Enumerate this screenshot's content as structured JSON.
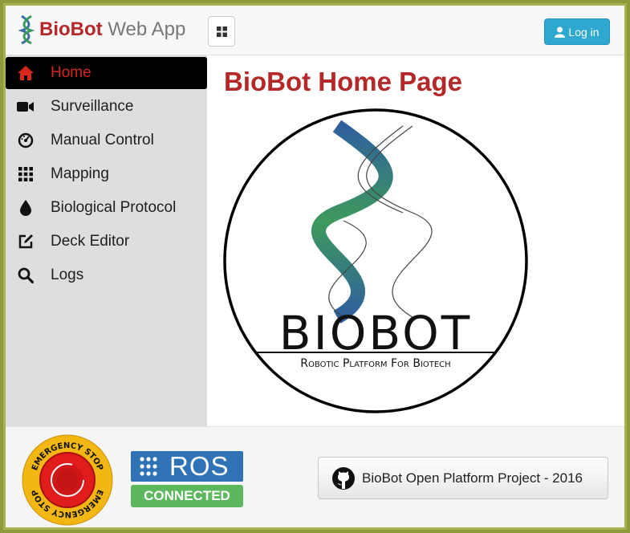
{
  "brand": {
    "bold": "BioBot",
    "light": "Web App"
  },
  "header": {
    "login_label": "Log in"
  },
  "sidebar": {
    "items": [
      {
        "label": "Home",
        "icon": "home-icon"
      },
      {
        "label": "Surveillance",
        "icon": "video-camera-icon"
      },
      {
        "label": "Manual Control",
        "icon": "dashboard-icon"
      },
      {
        "label": "Mapping",
        "icon": "grid-icon"
      },
      {
        "label": "Biological Protocol",
        "icon": "drop-icon"
      },
      {
        "label": "Deck Editor",
        "icon": "edit-icon"
      },
      {
        "label": "Logs",
        "icon": "search-icon"
      }
    ]
  },
  "main": {
    "title": "BioBot Home Page",
    "logo_name": "BIOBOT",
    "logo_tagline": "Robotic Platform For Biotech"
  },
  "footer": {
    "estop_label": "EMERGENCY STOP",
    "ros_label": "ROS",
    "ros_status": "CONNECTED",
    "github_label": "BioBot Open Platform Project - 2016"
  },
  "colors": {
    "brand_red": "#b42828",
    "login_blue": "#2ea8cf",
    "ros_blue": "#2f72b6",
    "connected_green": "#5cb85c",
    "helix_blue": "#3a6fa4",
    "helix_green": "#3d9a5c"
  }
}
